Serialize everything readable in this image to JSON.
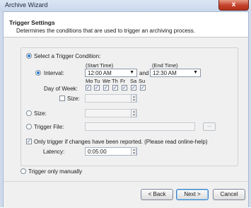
{
  "window": {
    "title": "Archive Wizard",
    "close_glyph": "x"
  },
  "header": {
    "title": "Trigger Settings",
    "subtitle": "Determines the conditions that are used to trigger an archiving process."
  },
  "trigger": {
    "select_label": "Select a Trigger Condition:",
    "interval_label": "Interval:",
    "start_time_header": "(Start Time)",
    "end_time_header": "(End Time)",
    "start_time": "12:00 AM",
    "end_time": "12:30 AM",
    "and_label": "and",
    "day_of_week_label": "Day of Week:",
    "days": [
      "Mo",
      "Tu",
      "We",
      "Th",
      "Fr",
      "Sa",
      "Su"
    ],
    "day_checked_glyph": "✓",
    "inner_size_label": "Size:",
    "size_label": "Size:",
    "trigger_file_label": "Trigger File:",
    "browse_label": "...",
    "only_trigger_label": "Only trigger if changes have been reported. (Please read online-help)",
    "latency_label": "Latency:",
    "latency_value": "0:05:00",
    "manual_label": "Trigger only manually"
  },
  "buttons": {
    "back": "< Back",
    "next": "Next >",
    "cancel": "Cancel"
  },
  "colors": {
    "accent": "#2a7bd6",
    "close": "#c2412a"
  }
}
